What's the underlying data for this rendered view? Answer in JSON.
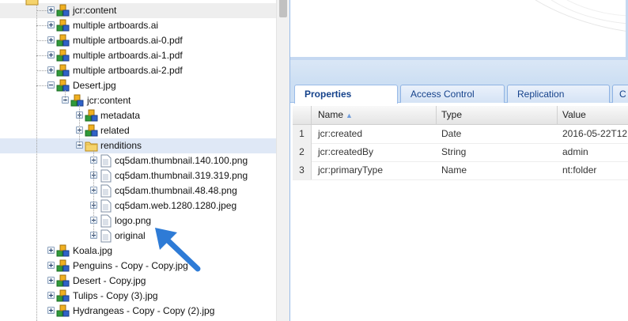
{
  "tree": {
    "nodes": [
      {
        "label": "jcr:content",
        "icon": "node-icon",
        "expander": "plus"
      },
      {
        "label": "multiple artboards.ai",
        "icon": "node-icon",
        "expander": "plus"
      },
      {
        "label": "multiple artboards.ai-0.pdf",
        "icon": "node-icon",
        "expander": "plus"
      },
      {
        "label": "multiple artboards.ai-1.pdf",
        "icon": "node-icon",
        "expander": "plus"
      },
      {
        "label": "multiple artboards.ai-2.pdf",
        "icon": "node-icon",
        "expander": "plus"
      },
      {
        "label": "Desert.jpg",
        "icon": "node-icon",
        "expander": "minus"
      },
      {
        "label": "jcr:content",
        "icon": "node-icon",
        "expander": "minus"
      },
      {
        "label": "metadata",
        "icon": "node-icon",
        "expander": "plus"
      },
      {
        "label": "related",
        "icon": "node-icon",
        "expander": "plus"
      },
      {
        "label": "renditions",
        "icon": "folder-icon",
        "expander": "minus"
      },
      {
        "label": "cq5dam.thumbnail.140.100.png",
        "icon": "file-icon",
        "expander": "plus"
      },
      {
        "label": "cq5dam.thumbnail.319.319.png",
        "icon": "file-icon",
        "expander": "plus"
      },
      {
        "label": "cq5dam.thumbnail.48.48.png",
        "icon": "file-icon",
        "expander": "plus"
      },
      {
        "label": "cq5dam.web.1280.1280.jpeg",
        "icon": "file-icon",
        "expander": "plus"
      },
      {
        "label": "logo.png",
        "icon": "file-icon",
        "expander": "plus"
      },
      {
        "label": "original",
        "icon": "file-icon",
        "expander": "plus"
      },
      {
        "label": "Koala.jpg",
        "icon": "node-icon",
        "expander": "plus"
      },
      {
        "label": "Penguins - Copy - Copy.jpg",
        "icon": "node-icon",
        "expander": "plus"
      },
      {
        "label": "Desert - Copy.jpg",
        "icon": "node-icon",
        "expander": "plus"
      },
      {
        "label": "Tulips - Copy (3).jpg",
        "icon": "node-icon",
        "expander": "plus"
      },
      {
        "label": "Hydrangeas - Copy - Copy (2).jpg",
        "icon": "node-icon",
        "expander": "plus"
      }
    ]
  },
  "tabs": [
    {
      "label": "Properties",
      "active": true
    },
    {
      "label": "Access Control",
      "active": false
    },
    {
      "label": "Replication",
      "active": false
    },
    {
      "label": "C",
      "active": false
    }
  ],
  "grid": {
    "columns": {
      "name": "Name",
      "type": "Type",
      "value": "Value"
    },
    "rows": [
      {
        "num": "1",
        "name": "jcr:created",
        "type": "Date",
        "value": "2016-05-22T12"
      },
      {
        "num": "2",
        "name": "jcr:createdBy",
        "type": "String",
        "value": "admin"
      },
      {
        "num": "3",
        "name": "jcr:primaryType",
        "type": "Name",
        "value": "nt:folder"
      }
    ]
  },
  "colors": {
    "accent": "#2e7bd6",
    "selection": "#dfe8f6",
    "tab_text": "#15428b"
  }
}
